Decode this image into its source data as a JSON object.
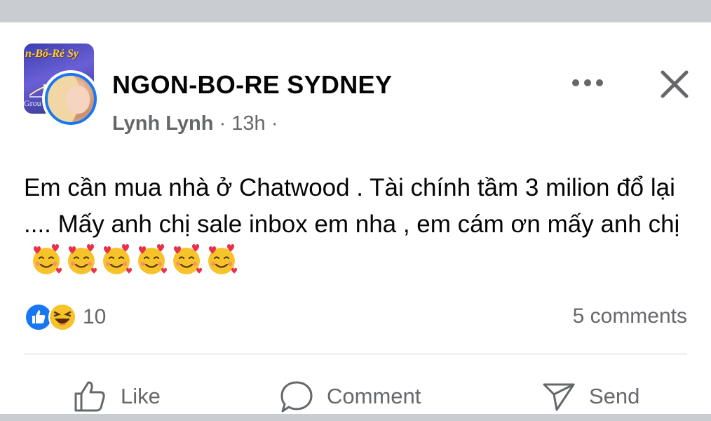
{
  "post": {
    "group_name": "NGON-BO-RE SYDNEY",
    "group_avatar_text_top": "n-Bổ-Rẻ Sy",
    "group_avatar_text_bottom": "Grou",
    "author": "Lynh Lynh",
    "separator": "·",
    "time": "13h",
    "privacy_separator": "·",
    "body_text": "Em cần mua nhà ở Chatwood . Tài chính tầm 3 milion đổ lại .... Mấy anh chị sale inbox em nha , em cám ơn mấy anh chị",
    "emoji_count": 6,
    "emoji_name": "smiling-face-with-hearts"
  },
  "reactions": {
    "types": [
      "like-icon",
      "haha-icon"
    ],
    "count": "10"
  },
  "comments_label": "5 comments",
  "actions": {
    "like_label": "Like",
    "comment_label": "Comment",
    "send_label": "Send"
  },
  "colors": {
    "facebook_blue": "#1877f2",
    "secondary_text": "#65676b",
    "primary_text": "#050505"
  }
}
